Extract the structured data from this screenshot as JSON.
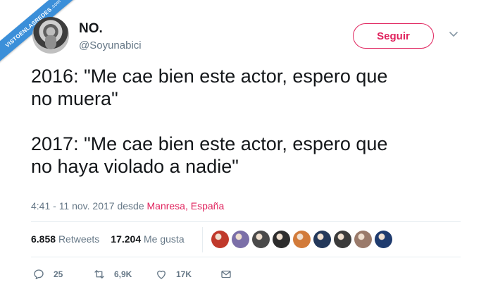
{
  "watermark": {
    "text": "VISTOENLASREDES",
    "suffix": ".com"
  },
  "user": {
    "name": "NO.",
    "handle": "@Soyunabici"
  },
  "follow_label": "Seguir",
  "tweet": {
    "text": "2016: \"Me cae bien este actor, espero que\nno muera\"\n\n2017: \"Me cae bien este actor, espero que\nno haya violado a nadie\""
  },
  "meta": {
    "time": "4:41 - 11 nov. 2017 desde ",
    "location": "Manresa, España"
  },
  "stats": {
    "retweets_value": "6.858",
    "retweets_label": "Retweets",
    "likes_value": "17.204",
    "likes_label": "Me gusta"
  },
  "likers": [
    "#c0392b",
    "#7b6fa8",
    "#4a4a4a",
    "#2d2d2d",
    "#d27b3a",
    "#23385a",
    "#3b3b3b",
    "#9a7a6a",
    "#1f3b6e"
  ],
  "actions": {
    "replies": "25",
    "retweets": "6,9K",
    "likes": "17K"
  },
  "colors": {
    "accent": "#e0245e",
    "badge": "#3b8fd9",
    "muted": "#657786"
  }
}
